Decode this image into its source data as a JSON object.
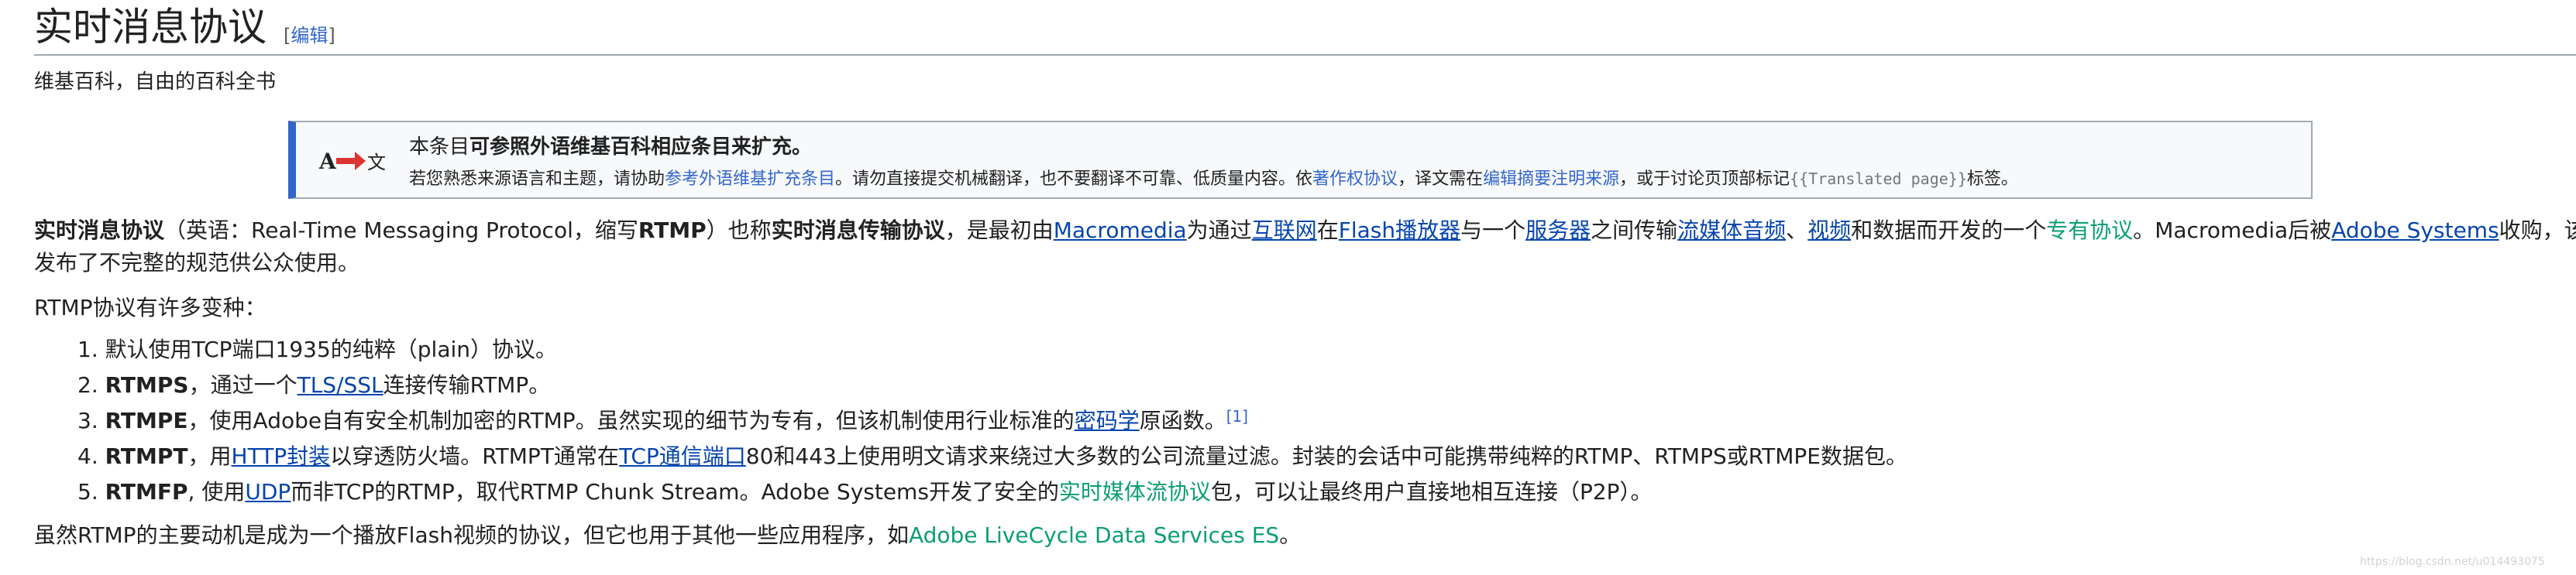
{
  "heading": {
    "title": "实时消息协议",
    "edit_open": "[",
    "edit_label": "编辑",
    "edit_close": "]"
  },
  "tagline": "维基百科，自由的百科全书",
  "notice": {
    "icon_from": "A",
    "icon_to": "文",
    "line1_pre": "本条目",
    "line1_bold": "可参照外语维基百科相应条目来扩充。",
    "line2_a": "若您熟悉来源语言和主题，请协助",
    "line2_link1": "参考外语维基扩充条目",
    "line2_b": "。请勿直接提交机械翻译，也不要翻译不可靠、低质量内容。依",
    "line2_link2": "著作权协议",
    "line2_c": "，译文需在",
    "line2_link3": "编辑摘要注明来源",
    "line2_d": "，或于讨论页顶部标记",
    "line2_template": "{{Translated page}}",
    "line2_e": "标签。"
  },
  "intro": {
    "term": "实时消息协议",
    "t1": "（英语：Real-Time Messaging Protocol，缩写",
    "abbr": "RTMP",
    "t2": "）也称",
    "alt_term": "实时消息传输协议",
    "t3": "，是最初由",
    "link_macromedia": "Macromedia",
    "t4": "为通过",
    "link_internet": "互联网",
    "t5": "在",
    "link_flash_player": "Flash播放器",
    "t6": "与一个",
    "link_server": "服务器",
    "t7": "之间传输",
    "link_streaming_audio": "流媒体音频",
    "t8": "、",
    "link_video": "视频",
    "t9": "和数据而开发的一个",
    "link_proprietary": "专有协议",
    "t10": "。Macromedia后被",
    "link_adobe": "Adobe Systems",
    "t11": "收购，该协议也已",
    "line2": "发布了不完整的规范供公众使用。"
  },
  "variants_intro": "RTMP协议有许多变种：",
  "variants": [
    {
      "num": "1.",
      "text": "默认使用TCP端口1935的纯粹（plain）协议。"
    },
    {
      "num": "2.",
      "bold": "RTMPS",
      "a": "，通过一个",
      "link": "TLS/SSL",
      "b": "连接传输RTMP。"
    },
    {
      "num": "3.",
      "bold": "RTMPE",
      "a": "，使用Adobe自有安全机制加密的RTMP。虽然实现的细节为专有，但该机制使用行业标准的",
      "link": "密码学",
      "b": "原函数。",
      "ref": "[1]"
    },
    {
      "num": "4.",
      "bold": "RTMPT",
      "a": "，用",
      "link": "HTTP封装",
      "b": "以穿透防火墙。RTMPT通常在",
      "link2": "TCP通信端口",
      "c": "80和443上使用明文请求来绕过大多数的公司流量过滤。封装的会话中可能携带纯粹的RTMP、RTMPS或RTMPE数据包。"
    },
    {
      "num": "5.",
      "bold": "RTMFP",
      "a": ", 使用",
      "link": "UDP",
      "b": "而非TCP的RTMP，取代RTMP Chunk Stream。Adobe Systems开发了安全的",
      "link2": "实时媒体流协议",
      "c": "包，可以让最终用户直接地相互连接（P2P）。"
    }
  ],
  "closing": {
    "text": "虽然RTMP的主要动机是成为一个播放Flash视频的协议，但它也用于其他一些应用程序，如",
    "link": "Adobe LiveCycle Data Services ES",
    "end": "。"
  },
  "watermark": "https://blog.csdn.net/u014493075",
  "colors": {
    "link": "#3366cc",
    "link_new": "#0b9e72",
    "notice_bar": "#3366cc",
    "icon_arrow": "#dd3333"
  }
}
